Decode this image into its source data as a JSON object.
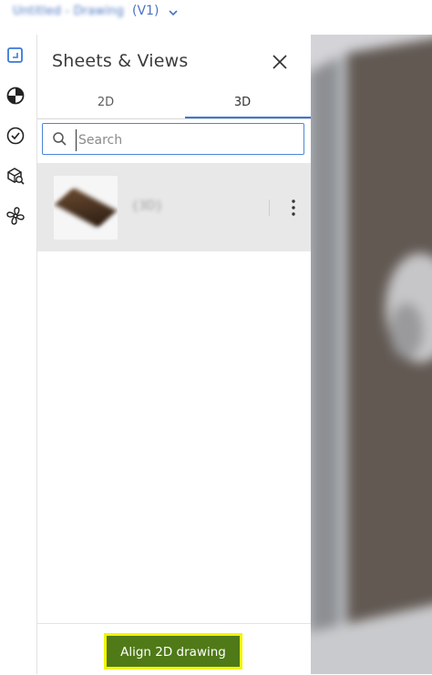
{
  "header": {
    "file_name": "Untitled - Drawing",
    "version": "(V1)",
    "dropdown_icon": "chevron-down-icon"
  },
  "rail": {
    "items": [
      {
        "name": "sheets-views-icon",
        "active": true
      },
      {
        "name": "model-browser-icon",
        "active": false
      },
      {
        "name": "issues-icon",
        "active": false
      },
      {
        "name": "search-model-icon",
        "active": false
      },
      {
        "name": "fan-icon",
        "active": false
      }
    ]
  },
  "panel": {
    "title": "Sheets & Views",
    "close_icon": "close-icon",
    "tabs": [
      {
        "label": "2D",
        "active": false
      },
      {
        "label": "3D",
        "active": true
      }
    ],
    "search": {
      "placeholder": "Search",
      "value": ""
    },
    "items": [
      {
        "label": "{3D}",
        "more_icon": "more-vertical-icon"
      }
    ],
    "footer_button": "Align 2D drawing"
  },
  "colors": {
    "accent": "#3b78d8",
    "button_bg": "#4f7a17",
    "button_highlight": "#f2f500",
    "viewport_bg": "#5e5550"
  }
}
